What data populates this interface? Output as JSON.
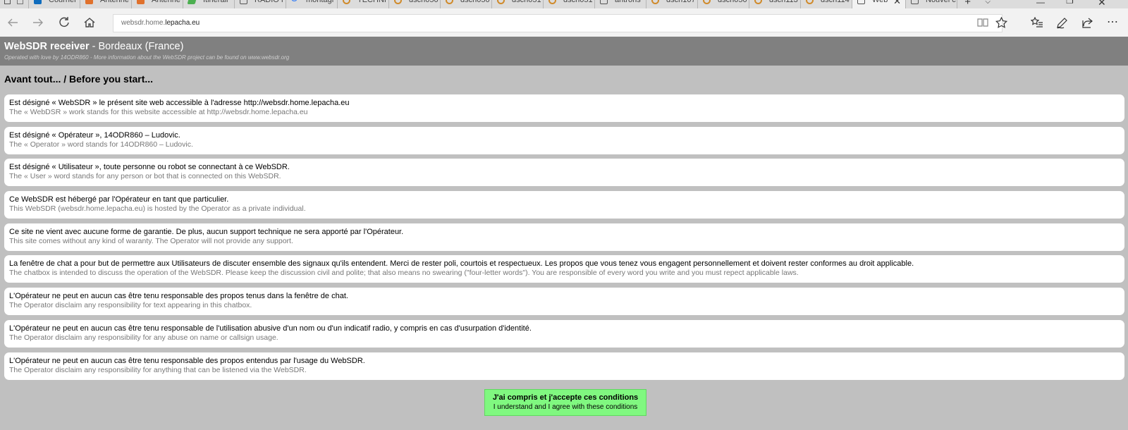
{
  "browser": {
    "tabs": [
      {
        "label": "Courrier",
        "icon": "outlook-icon",
        "kind": "ms"
      },
      {
        "label": "Antenne",
        "icon": "antenna-site-icon",
        "kind": "ant"
      },
      {
        "label": "Antenne",
        "icon": "antenna-site-icon",
        "kind": "ant"
      },
      {
        "label": "Itinérair",
        "icon": "itinerary-icon",
        "kind": "itin"
      },
      {
        "label": "RADIO F",
        "icon": "page-icon",
        "kind": "page"
      },
      {
        "label": "montagi",
        "icon": "google-icon",
        "kind": "goog"
      },
      {
        "label": "TECHNI",
        "icon": "schematic-icon",
        "kind": "sch"
      },
      {
        "label": "dsch050",
        "icon": "schematic-icon",
        "kind": "sch"
      },
      {
        "label": "dsch050",
        "icon": "schematic-icon",
        "kind": "sch"
      },
      {
        "label": "dsch051",
        "icon": "schematic-icon",
        "kind": "sch"
      },
      {
        "label": "dsch051",
        "icon": "schematic-icon",
        "kind": "sch"
      },
      {
        "label": "antrons",
        "icon": "page-icon",
        "kind": "page"
      },
      {
        "label": "dsch107",
        "icon": "schematic-icon",
        "kind": "sch"
      },
      {
        "label": "dsch050",
        "icon": "schematic-icon",
        "kind": "sch"
      },
      {
        "label": "dsch113",
        "icon": "schematic-icon",
        "kind": "sch"
      },
      {
        "label": "dsch114",
        "icon": "schematic-icon",
        "kind": "sch"
      },
      {
        "label": "Web",
        "icon": "page-icon",
        "kind": "page",
        "active": true
      },
      {
        "label": "Nouvel c",
        "icon": "new-tab-icon",
        "kind": "nouv"
      }
    ],
    "url_prefix": "websdr.home.",
    "url_domain": "lepacha.eu"
  },
  "header": {
    "title": "WebSDR receiver",
    "location": "- Bordeaux (France)",
    "subtitle": "Operated with love by 14ODR860 - More information about the WebSDR project can be found on www.websdr.org"
  },
  "main": {
    "heading": "Avant tout... / Before you start...",
    "items": [
      {
        "fr": "Est désigné « WebSDR » le présent site web accessible à l'adresse http://websdr.home.lepacha.eu",
        "en": "The « WebDSR » work stands for this website accessible at http://websdr.home.lepacha.eu"
      },
      {
        "fr": "Est désigné « Opérateur », 14ODR860 – Ludovic.",
        "en": "The « Operator » word stands for 14ODR860 – Ludovic."
      },
      {
        "fr": "Est désigné « Utilisateur », toute personne ou robot se connectant à ce WebSDR.",
        "en": "The « User » word stands for any person or bot that is connected on this WebSDR."
      },
      {
        "fr": "Ce WebSDR est hébergé par l'Opérateur en tant que particulier.",
        "en": "This WebSDR (websdr.home.lepacha.eu) is hosted by the Operator as a private individual."
      },
      {
        "fr": "Ce site ne vient avec aucune forme de garantie. De plus, aucun support technique ne sera apporté par l'Opérateur.",
        "en": "This site comes without any kind of waranty. The Operator will not provide any support."
      },
      {
        "fr": "La fenêtre de chat a pour but de permettre aux Utilisateurs de discuter ensemble des signaux qu'ils entendent. Merci de rester poli, courtois et respectueux. Les propos que vous tenez vous engagent personnellement et doivent rester conformes au droit applicable.",
        "en": "The chatbox is intended to discuss the operation of the WebSDR. Please keep the discussion civil and polite; that also means no swearing (\"four-letter words\"). You are responsible of every word you write and you must repect applicable laws."
      },
      {
        "fr": "L'Opérateur ne peut en aucun cas être tenu responsable des propos tenus dans la fenêtre de chat.",
        "en": "The Operator disclaim any responsibility for text appearing in this chatbox."
      },
      {
        "fr": "L'Opérateur ne peut en aucun cas être tenu responsable de l'utilisation abusive d'un nom ou d'un indicatif radio, y compris en cas d'usurpation d'identité.",
        "en": "The Operator disclaim any responsibility for any abuse on name or callsign usage."
      },
      {
        "fr": "L'Opérateur ne peut en aucun cas être tenu responsable des propos entendus par l'usage du WebSDR.",
        "en": "The Operator disclaim any responsibility for anything that can be listened via the WebSDR."
      }
    ],
    "accept_fr": "J'ai compris et j'accepte ces conditions",
    "accept_en": "I understand and I agree with these conditions"
  }
}
